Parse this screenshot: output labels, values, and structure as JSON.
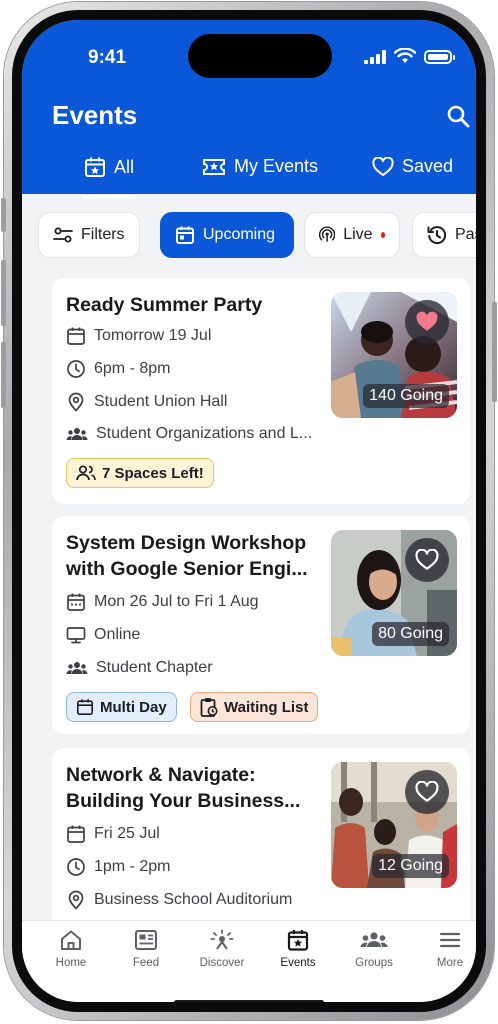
{
  "status": {
    "time": "9:41"
  },
  "header": {
    "title": "Events"
  },
  "tabs": [
    {
      "label": "All",
      "active": true
    },
    {
      "label": "My Events"
    },
    {
      "label": "Saved"
    }
  ],
  "filters": {
    "filters_label": "Filters",
    "upcoming_label": "Upcoming",
    "live_label": "Live",
    "past_label": "Past"
  },
  "events": [
    {
      "title": "Ready Summer Party",
      "date": "Tomorrow 19 Jul",
      "time": "6pm - 8pm",
      "location": "Student Union Hall",
      "organizer": "Student Organizations and L...",
      "going": "140 Going",
      "favorited": true,
      "badges": [
        {
          "label": "7 Spaces Left!",
          "color": "#fff4d6"
        }
      ]
    },
    {
      "title": "System Design Workshop with Google Senior Engi...",
      "date": "Mon 26 Jul to Fri 1 Aug",
      "location": "Online",
      "organizer": "Student Chapter",
      "going": "80 Going",
      "favorited": false,
      "badges": [
        {
          "label": "Multi Day",
          "color": "#e3eefc"
        },
        {
          "label": "Waiting List",
          "color": "#fde6d9"
        }
      ]
    },
    {
      "title": "Network & Navigate: Building Your Business...",
      "date": "Fri 25 Jul",
      "time": "1pm - 2pm",
      "location": "Business School Auditorium",
      "going": "12 Going",
      "favorited": false
    }
  ],
  "bottom_nav": [
    {
      "label": "Home",
      "icon": "home-icon"
    },
    {
      "label": "Feed",
      "icon": "feed-icon"
    },
    {
      "label": "Discover",
      "icon": "discover-icon"
    },
    {
      "label": "Events",
      "icon": "events-icon",
      "active": true
    },
    {
      "label": "Groups",
      "icon": "groups-icon"
    },
    {
      "label": "More",
      "icon": "menu-icon"
    }
  ],
  "colors": {
    "brand": "#0a57d8",
    "favorite": "#f07a8c",
    "live_dot": "#e2231a"
  }
}
